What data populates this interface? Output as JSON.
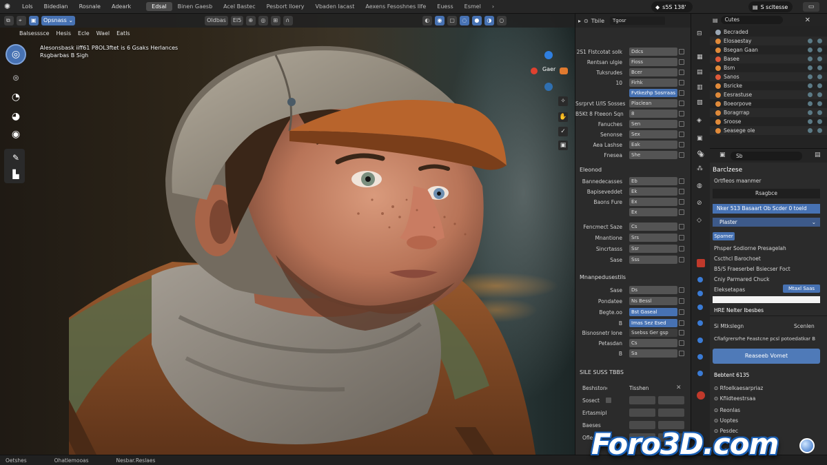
{
  "topbar": {
    "menus": [
      "Lols",
      "Bidedian",
      "Rosnale",
      "Adeark"
    ],
    "workspaces": [
      "Edsal",
      "Binen Gaesb",
      "Acel Bastec",
      "Pesbort lloery",
      "Vbaden Iacast",
      "Aexens Fesoshnes IIfe",
      "Euess",
      "Esmel"
    ],
    "active_workspace": "Edsal",
    "scene": "s5S 138'",
    "view_layer": "S scltesse"
  },
  "viewport": {
    "mode": "Opsnass",
    "header_field": "Oldbas",
    "header_num": "EI5",
    "menu": [
      "Balsesssce",
      "Hesis",
      "Ecle",
      "Wael",
      "Eatls"
    ],
    "info_line1": "Alesonsbask iiff61 P8OL3ftet is 6 Gsaks Herlances",
    "info_line2": "Rsgbarbas B Sigh",
    "gizmo_label": "Gaer"
  },
  "props": {
    "header": "Tbile",
    "top_title": "Tgosr",
    "rows1": [
      {
        "label": "2S1 Flstcotat solk",
        "value": "Ddcs"
      },
      {
        "label": "Rentsan ulgie",
        "value": "Fioss"
      },
      {
        "label": "Tuksrudes",
        "value": "Bcer"
      },
      {
        "label": "10",
        "value": "Firhk"
      },
      {
        "label": "",
        "value": "Fvtkezhp Sosrraas"
      },
      {
        "label": "Ssrprvt U/IS Sosses",
        "value": "Placlean"
      },
      {
        "label": "B5Kt 8 Fteeon Sqn",
        "value": "8"
      },
      {
        "label": "Fanuches",
        "value": "Sen"
      },
      {
        "label": "Senonse",
        "value": "Sex"
      },
      {
        "label": "Aea Lashse",
        "value": "Eak"
      },
      {
        "label": "Fnesea",
        "value": "She"
      }
    ],
    "section2": "Eleonod",
    "rows2": [
      {
        "label": "Bannedecasses",
        "value": "Eb"
      },
      {
        "label": "Bapiseveddet",
        "value": "Ek"
      },
      {
        "label": "Baons Fure",
        "value": "Ex"
      },
      {
        "label": "",
        "value": "Ex"
      }
    ],
    "rows3": [
      {
        "label": "Fencmect Saze",
        "value": "Cs"
      },
      {
        "label": "Mnantione",
        "value": "Srs"
      },
      {
        "label": "Sincrtasss",
        "value": "Ssr"
      },
      {
        "label": "Sase",
        "value": "Sss"
      }
    ],
    "section3": "Mnanpedusestils",
    "rows4": [
      {
        "label": "Sase",
        "value": "Ds"
      },
      {
        "label": "Pondatee",
        "value": "Ns Bessl"
      },
      {
        "label": "Begte.oo",
        "value": "Bst Gaseal"
      },
      {
        "label": "B",
        "value": "Imas Sez Esed"
      }
    ],
    "rows5": [
      {
        "label": "Bisnosnetr Ione",
        "value": "Ssebss Ger gsp"
      },
      {
        "label": "Petasdan",
        "value": "Cs"
      },
      {
        "label": "B",
        "value": "Sa"
      }
    ],
    "section4": "SILE SUSS TBBS",
    "rows6": [
      {
        "label": "Beshstone",
        "value": "Tisshen"
      },
      {
        "label": "Sosect",
        "value": ""
      },
      {
        "label": "Ertasmiple",
        "value": ""
      },
      {
        "label": "Baeses",
        "value": ""
      },
      {
        "label": "Ofle",
        "value": ""
      }
    ]
  },
  "outliner": {
    "title": "Cutes",
    "items": [
      {
        "name": "Becraded",
        "color": "#9aa7b5"
      },
      {
        "name": "Elosaestay",
        "color": "#e08a3a"
      },
      {
        "name": "Bsegan Gaan",
        "color": "#e08a3a"
      },
      {
        "name": "Basee",
        "color": "#e05a3a"
      },
      {
        "name": "Bsm",
        "color": "#e08a3a"
      },
      {
        "name": "Sanos",
        "color": "#e05a3a"
      },
      {
        "name": "Bsricke",
        "color": "#e08a3a"
      },
      {
        "name": "Eesrastuse",
        "color": "#e08a3a"
      },
      {
        "name": "Boeorpove",
        "color": "#e08a3a"
      },
      {
        "name": "Boragrrap",
        "color": "#e08a3a"
      },
      {
        "name": "Sroose",
        "color": "#e08a3a"
      },
      {
        "name": "Seasege ole",
        "color": "#e08a3a"
      }
    ]
  },
  "rprops": {
    "search": "Sb",
    "title": "Barclzese",
    "subtitle": "Ortfleos maanmer",
    "tab": "Rsagbce",
    "field1": "Nker 513 Basaart Ob Scder 0 toeld",
    "dropdown": "Plaster",
    "button_small": "Sparner",
    "lines": [
      "Phsper Sodiorne Presagelah",
      "Cscthcl Barochoet",
      "B5/S Fraeserbel Bsiecser Foct",
      "Cniy Parmared Chuck"
    ],
    "row_label": "Eleksetapas",
    "row_button": "Mtaxl Saas",
    "highlight": "HRE Nelter Ibesbes",
    "sub_label": "Si Mtkslegn",
    "sub_value": "Scenlen",
    "desc": "Cfiafgrersrhe Feastcne pcsl potoedatkar B",
    "big_button": "Reaseeb Vomet",
    "section": "Bebtent 6135",
    "list": [
      "Rfoelkaesarpriaz",
      "Kfiidteestrsaa",
      "Reonlas",
      "Uoptes",
      "Pesdec"
    ]
  },
  "status": [
    "Oetshes",
    "Ohatlemooas",
    "Nesbar.Reslaes"
  ],
  "watermark": "Foro3D.com"
}
